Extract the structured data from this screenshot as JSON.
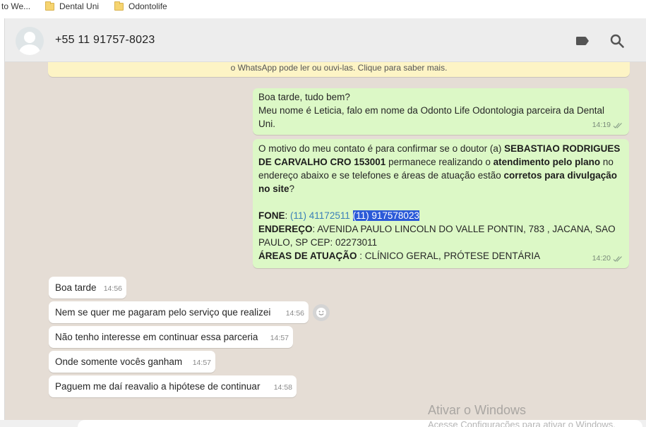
{
  "bookmarks": [
    {
      "label": "to We..."
    },
    {
      "label": "Dental Uni"
    },
    {
      "label": "Odontolife"
    }
  ],
  "header": {
    "contact_name": "+55 11 91757-8023",
    "icons": [
      "label-icon",
      "search-icon"
    ]
  },
  "notice": {
    "text": "o WhatsApp pode ler ou ouvi-las. Clique para saber mais."
  },
  "messages": {
    "m1": {
      "text": "Boa tarde, tudo bem?\nMeu nome é Leticia, falo em nome da Odonto Life Odontologia parceira da Dental Uni.",
      "time": "14:19"
    },
    "m2": {
      "p1": "O motivo do meu contato é para confirmar se o doutor (a) ",
      "doctor": "SEBASTIAO RODRIGUES DE CARVALHO  CRO 153001",
      "p2": " permanece realizando o ",
      "b1": "atendimento pelo plano",
      "p3": " no endereço abaixo e se telefones e áreas de atuação estão ",
      "b2": "corretos para divulgação no site",
      "p4": "?",
      "fone_label": "FONE",
      "colon1": ": ",
      "phone1": "(11) 41172511",
      "phone2": "(11) 917578023",
      "endereco_label": "ENDEREÇO",
      "endereco": ": AVENIDA PAULO LINCOLN DO VALLE PONTIN, 783 , JACANA, SAO PAULO, SP CEP: 02273011",
      "areas_label": "ÁREAS DE ATUAÇÃO",
      "areas": " : CLÍNICO GERAL, PRÓTESE DENTÁRIA",
      "time": "14:20"
    },
    "r1": {
      "text": "Boa tarde",
      "time": "14:56"
    },
    "r2": {
      "text": "Nem se quer me pagaram pelo serviço que realizei",
      "time": "14:56"
    },
    "r3": {
      "text": "Não tenho interesse em continuar essa parceria",
      "time": "14:57"
    },
    "r4": {
      "text": "Onde somente vocês ganham",
      "time": "14:57"
    },
    "r5": {
      "text": "Paguem me daí reavalio a hipótese de continuar",
      "time": "14:58"
    }
  },
  "watermark": {
    "line1": "Ativar o Windows",
    "line2": "Acesse Configurações para ativar o Windows."
  },
  "colors": {
    "outgoing": "#dcf8c6",
    "incoming": "#ffffff",
    "header": "#ededed",
    "chat_bg": "#e5ddd5",
    "selection": "#2b5ad8",
    "link": "#3a7fb8"
  }
}
